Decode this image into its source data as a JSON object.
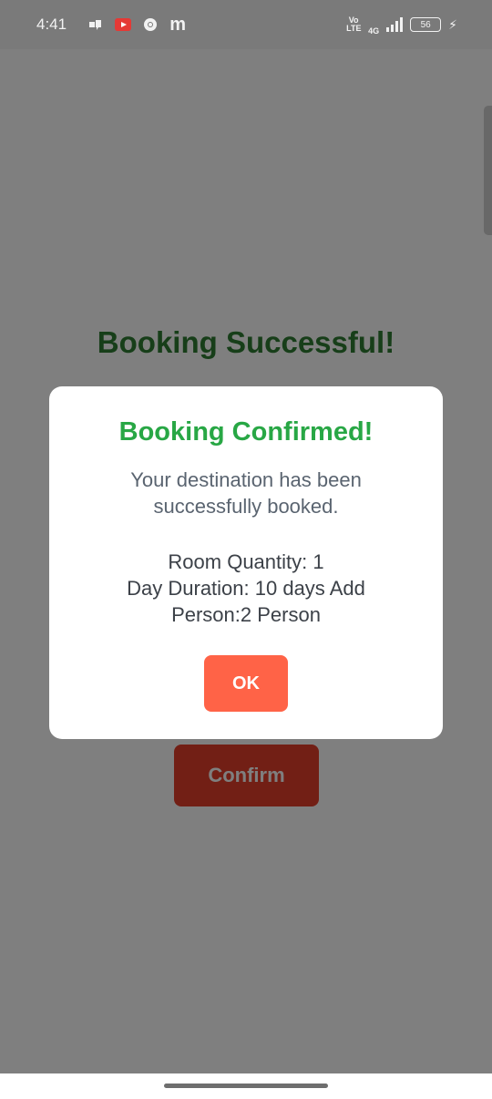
{
  "status_bar": {
    "time": "4:41",
    "left_icons": [
      "notification-icon",
      "youtube-icon",
      "chrome-icon",
      "m-app-icon"
    ],
    "m_glyph": "m",
    "volte_label": "Vo LTE",
    "network_label": "4G",
    "battery_level": "56"
  },
  "page": {
    "title": "Booking Successful!",
    "confirm_label": "Confirm"
  },
  "dialog": {
    "title": "Booking Confirmed!",
    "message": "Your destination has been successfully booked.",
    "details": {
      "room_quantity": "Room Quantity: 1",
      "day_duration": "Day Duration: 10 days Add",
      "person": "Person:2 Person"
    },
    "ok_label": "OK"
  },
  "colors": {
    "title_green": "#2e7d32",
    "dialog_title_green": "#28a745",
    "ok_button": "#ff6347",
    "confirm_button": "#e53e2a"
  }
}
